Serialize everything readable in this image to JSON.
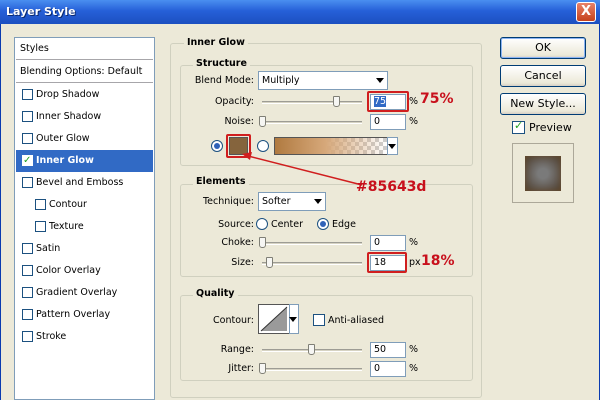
{
  "window": {
    "title": "Layer Style",
    "close_glyph": "X"
  },
  "styles_list": {
    "header": "Styles",
    "blending": "Blending Options: Default",
    "items": [
      {
        "label": "Drop Shadow",
        "checked": false
      },
      {
        "label": "Inner Shadow",
        "checked": false
      },
      {
        "label": "Outer Glow",
        "checked": false
      },
      {
        "label": "Inner Glow",
        "checked": true,
        "selected": true
      },
      {
        "label": "Bevel and Emboss",
        "checked": false
      },
      {
        "label": "Contour",
        "checked": false,
        "indent": true
      },
      {
        "label": "Texture",
        "checked": false,
        "indent": true
      },
      {
        "label": "Satin",
        "checked": false
      },
      {
        "label": "Color Overlay",
        "checked": false
      },
      {
        "label": "Gradient Overlay",
        "checked": false
      },
      {
        "label": "Pattern Overlay",
        "checked": false
      },
      {
        "label": "Stroke",
        "checked": false
      }
    ]
  },
  "panel": {
    "title": "Inner Glow"
  },
  "structure": {
    "title": "Structure",
    "blend_mode_label": "Blend Mode:",
    "blend_mode_value": "Multiply",
    "opacity_label": "Opacity:",
    "opacity_value": "75",
    "opacity_unit": "%",
    "opacity_level": 0.75,
    "noise_label": "Noise:",
    "noise_value": "0",
    "noise_unit": "%",
    "noise_level": 0,
    "glow_color": "#85643d"
  },
  "elements": {
    "title": "Elements",
    "technique_label": "Technique:",
    "technique_value": "Softer",
    "source_label": "Source:",
    "source_center": "Center",
    "source_edge": "Edge",
    "choke_label": "Choke:",
    "choke_value": "0",
    "choke_unit": "%",
    "choke_level": 0,
    "size_label": "Size:",
    "size_value": "18",
    "size_unit": "px",
    "size_level": 0.07
  },
  "quality": {
    "title": "Quality",
    "contour_label": "Contour:",
    "anti_aliased_label": "Anti-aliased",
    "range_label": "Range:",
    "range_value": "50",
    "range_unit": "%",
    "range_level": 0.5,
    "jitter_label": "Jitter:",
    "jitter_value": "0",
    "jitter_unit": "%",
    "jitter_level": 0
  },
  "buttons": {
    "ok": "OK",
    "cancel": "Cancel",
    "new_style": "New Style...",
    "preview_label": "Preview"
  },
  "annotations": {
    "opacity_note": "75%",
    "color_note": "#85643d",
    "size_note": "18%"
  },
  "colors": {
    "annotation_red": "#c8101c",
    "selection_blue": "#316ac5",
    "title_bar": "#2660d8"
  }
}
